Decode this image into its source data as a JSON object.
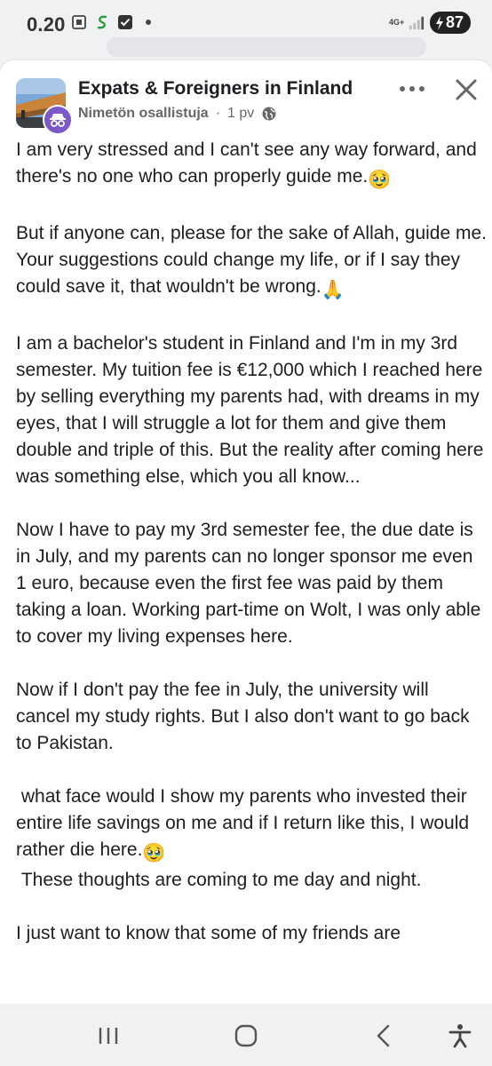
{
  "status_bar": {
    "time": "0.20",
    "network": "4G+",
    "battery": "87",
    "icons": [
      "screenshot-icon",
      "app-s-icon",
      "checkbox-notification-icon",
      "dot-icon",
      "signal-icon",
      "charging-icon"
    ]
  },
  "post": {
    "group_name": "Expats & Foreigners in Finland",
    "author": "Nimetön osallistuja",
    "separator": "·",
    "time_ago": "1 pv",
    "paragraphs": [
      "I am very stressed and I can't see any way forward, and there's no one who can properly guide me.",
      "But if anyone can, please for the sake of Allah, guide me. Your suggestions could change my life, or if I say they could save it, that wouldn't be wrong.",
      "I am a bachelor's student in Finland and I'm in my 3rd semester. My tuition fee is €12,000 which I reached here by selling everything my parents had, with dreams in my eyes, that I will struggle a lot for them and give them double and triple of this. But the reality after coming here was something else, which you all know...",
      "Now I have to pay my 3rd semester fee, the due date is in July, and my parents can no longer sponsor me even 1 euro, because even the first fee was paid by them taking a loan. Working part-time on Wolt, I was only able to cover my living expenses here.",
      "Now if I don't pay the fee in July, the university will cancel my study rights. But I also don't want to go back to Pakistan.",
      " what face would I show my parents who invested their entire life savings on me and if I return like this, I would rather die here.",
      " These thoughts are coming to me day and night.",
      "I just want to know that some of my friends are"
    ],
    "emojis": {
      "pleading": "🥹",
      "pray": "🙏"
    }
  },
  "colors": {
    "card_bg": "#ffffff",
    "page_bg": "#f2f3f5",
    "text": "#1c1e21",
    "meta": "#65676b",
    "anon_avatar": "#7b5ac8"
  }
}
